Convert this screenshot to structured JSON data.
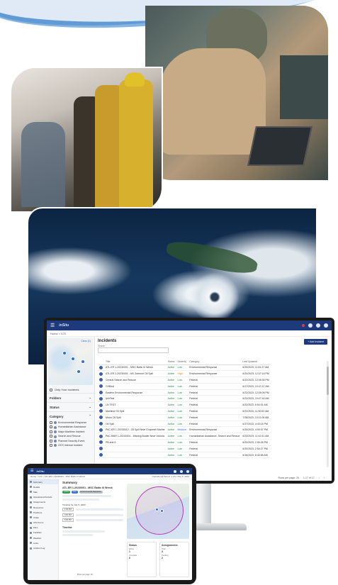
{
  "colors": {
    "brand_navy": "#1d3a7a",
    "wave_dark": "#1a57a8",
    "wave_light": "#6fa7dd",
    "status_green": "#1f8a3a",
    "severity_high": "#d98b00",
    "severity_medium": "#2f6fd0",
    "tablet_circle": "#b23bbd"
  },
  "monitor": {
    "brand": "inSitu",
    "breadcrumb": "Home  >  ICS",
    "sidebar": {
      "clear_label": "Clear (1)",
      "only_mine_label": "Only Your Incidents",
      "sections": {
        "folders": "Folders",
        "status": "Status",
        "category": "Category"
      },
      "categories": [
        "Environmental Response",
        "Humanitarian Assistance",
        "Major Maritime Incident",
        "Search and Rescue",
        "Planned Security Event",
        "OCS Internal Incident"
      ]
    },
    "main": {
      "title": "Incidents",
      "search_label": "Search",
      "search_placeholder": "",
      "add_button": "+ Add Incident",
      "columns": [
        "Title",
        "Status",
        "Severity",
        "Category",
        "Last Updated"
      ],
      "rows": [
        {
          "title": "ATL-ER 1-20230001 - MSC Baltic III Wreck",
          "status": "Active",
          "severity": "Low",
          "category": "Environmental Response",
          "updated": "6/20/2023, 11:51:37 AM"
        },
        {
          "title": "ATL-ER 2-20230001 - MV Zeemon Oil Spill",
          "status": "Active",
          "severity": "High",
          "category": "Environmental Response",
          "updated": "6/20/2023, 12:07:16 PM"
        },
        {
          "title": "Central Search and Rescue",
          "status": "Active",
          "severity": "Low",
          "category": "Federal",
          "updated": "6/22/2023, 12:05:36 PM"
        },
        {
          "title": "CHBest",
          "status": "Active",
          "severity": "Low",
          "category": "Federal",
          "updated": "6/17/2023, 10:47:47 AM"
        },
        {
          "title": "Eastern Environmental Response",
          "status": "Active",
          "severity": "Low",
          "category": "Federal",
          "updated": "6/22/2023, 12:05:06 PM"
        },
        {
          "title": "IpInTest",
          "status": "Active",
          "severity": "Low",
          "category": "Federal",
          "updated": "6/22/2023, 10:47:44 AM"
        },
        {
          "title": "LN TEST",
          "status": "Active",
          "severity": "Low",
          "category": "Federal",
          "updated": "5/22/2023, 6:54:01 AM"
        },
        {
          "title": "Maritime Oil Spill",
          "status": "Active",
          "severity": "Low",
          "category": "Federal",
          "updated": "5/22/2023, 11:50:52 AM"
        },
        {
          "title": "Motor Oil Spill",
          "status": "Active",
          "severity": "Low",
          "category": "Federal",
          "updated": "7/28/2023, 10:11:06 AM"
        },
        {
          "title": "Oil Spill",
          "status": "Active",
          "severity": "Low",
          "category": "Federal",
          "updated": "6/17/2023, 4:43:15 PM"
        },
        {
          "title": "PAC-ER 1-20230012 - Oil Spill Near Chopmell Marine",
          "status": "Active",
          "severity": "Medium",
          "category": "Environmental Response",
          "updated": "6/20/2023, 4:09:47 PM"
        },
        {
          "title": "PAC-MAR 1-20230001 - Missing Boater Near Victoria",
          "status": "Active",
          "severity": "Low",
          "category": "Humanitarian Assistance, Search and Rescue",
          "updated": "6/23/2023, 11:42:41 AM"
        },
        {
          "title": "PB-test 5",
          "status": "Active",
          "severity": "Low",
          "category": "Federal",
          "updated": "6/20/2023, 2:06:28 PM"
        },
        {
          "title": "",
          "status": "Active",
          "severity": "Low",
          "category": "Federal",
          "updated": "6/20/2023, 2:54:27 PM"
        },
        {
          "title": "",
          "status": "Active",
          "severity": "Low",
          "category": "Federal",
          "updated": "6/16/2023, 8:40:58 AM"
        }
      ],
      "pager": {
        "rows_per_page": "Rows per page: 20",
        "range": "1-17 of 17"
      }
    }
  },
  "tablet": {
    "brand": "inSitu",
    "breadcrumb": "Home  >  ICS  >  ATL-ER 1-20230001 - MSC Baltic III Wreck",
    "breadcrumb_right": "Operational Period: 1 | Fri, May 5, 2023",
    "nav": [
      "Summary",
      "Details",
      "Map",
      "Operational Periods",
      "Assignments",
      "Resources",
      "Positions",
      "Chats",
      "ICS Forms",
      "Files",
      "Facilities",
      "Weather",
      "Links",
      "Incident Log"
    ],
    "summary": {
      "heading": "Summary",
      "incident_title": "ATL-ER 1-20230001 - MSC Baltic III Wreck",
      "pills": [
        "Active",
        "Low",
        "Environmental Response"
      ],
      "period_label": "Timeline for July 5, 2023",
      "timeline_times": [
        "1:00 PM",
        "4:00 PM",
        "6:00 PM"
      ],
      "timeline_section": "Timeline",
      "pager": "Rows per page: 20"
    },
    "cards": {
      "status_card": {
        "title": "Status",
        "items": [
          {
            "label": "Active",
            "value": "1"
          },
          {
            "label": "Complete",
            "value": "0"
          }
        ]
      },
      "assignments_card": {
        "title": "Assignments",
        "items": [
          {
            "label": "Total",
            "value": "3"
          },
          {
            "label": "Pending",
            "value": "2"
          }
        ]
      }
    }
  }
}
